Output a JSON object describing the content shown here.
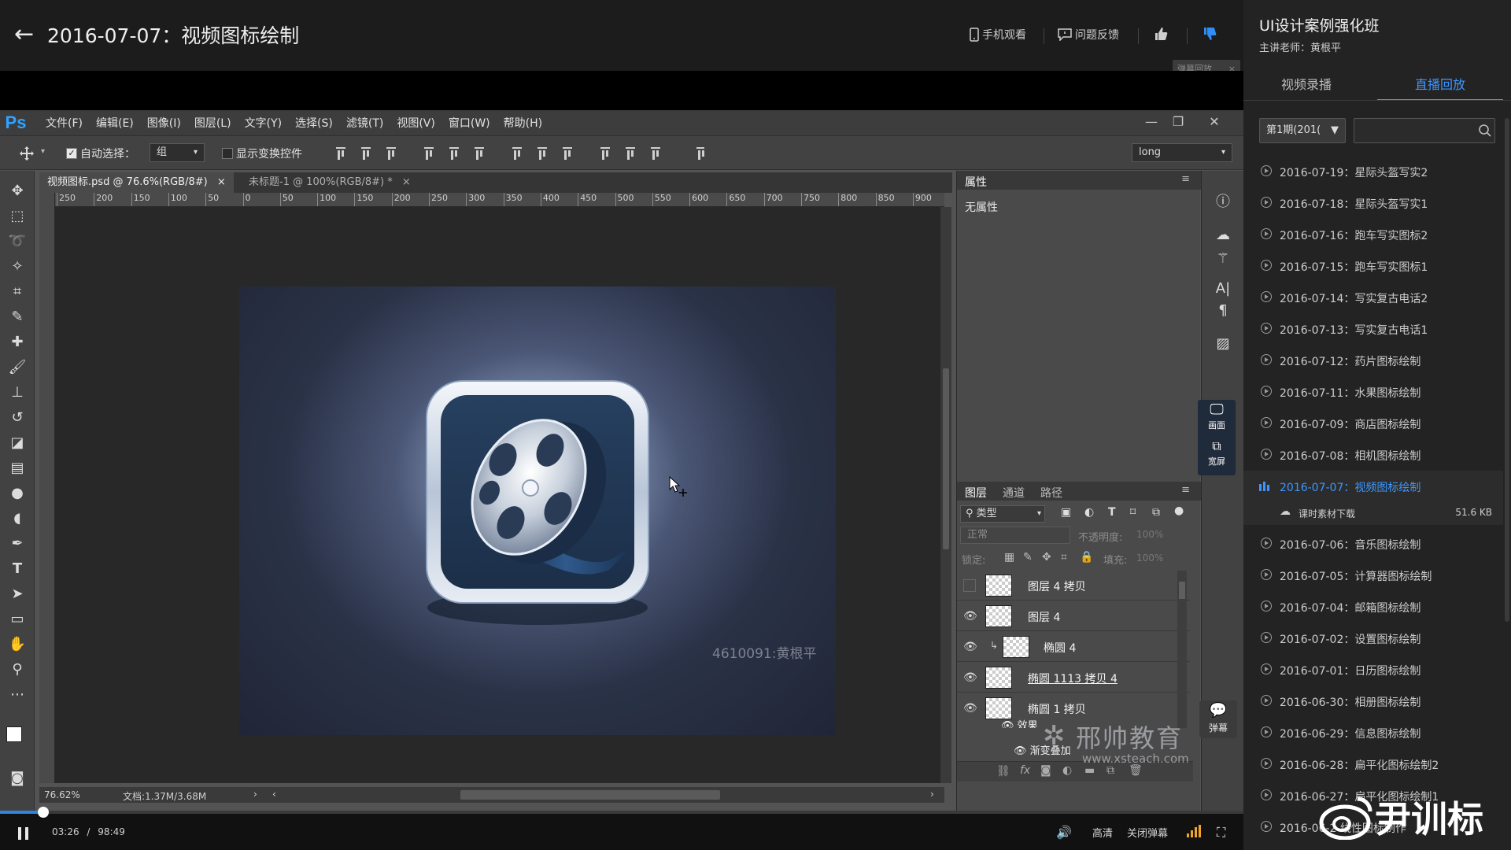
{
  "header": {
    "title": "2016-07-07：视频图标绘制",
    "mobile_watch": "手机观看",
    "feedback": "问题反馈",
    "danmu_replay": "弹幕回放",
    "danmu_replay_close": "×"
  },
  "photoshop": {
    "logo": "Ps",
    "menu": [
      "文件(F)",
      "编辑(E)",
      "图像(I)",
      "图层(L)",
      "文字(Y)",
      "选择(S)",
      "滤镜(T)",
      "视图(V)",
      "窗口(W)",
      "帮助(H)"
    ],
    "options": {
      "auto_select_label": "自动选择：",
      "auto_select_value": "组",
      "show_transform_label": "显示变换控件",
      "workspace_value": "long"
    },
    "tabs": [
      {
        "label": "视频图标.psd @ 76.6%(RGB/8#)",
        "close": "×"
      },
      {
        "label": "未标题-1 @ 100%(RGB/8#) *",
        "close": "×"
      }
    ],
    "ruler_ticks": [
      "250",
      "200",
      "150",
      "100",
      "50",
      "0",
      "50",
      "100",
      "150",
      "200",
      "250",
      "300",
      "350",
      "400",
      "450",
      "500",
      "550",
      "600",
      "650",
      "700",
      "750",
      "800",
      "850",
      "900"
    ],
    "canvas_watermark": "4610091:黄根平",
    "status": {
      "zoom": "76.62%",
      "doc": "文档:1.37M/3.68M"
    },
    "properties": {
      "title": "属性",
      "empty": "无属性"
    },
    "layers_panel": {
      "tabs": [
        "图层",
        "通道",
        "路径"
      ],
      "filter_label": "类型",
      "blend_mode": "正常",
      "opacity_label": "不透明度:",
      "opacity_value": "100%",
      "lock_label": "锁定:",
      "fill_label": "填充:",
      "fill_value": "100%",
      "layers": [
        {
          "name": "图层 4 拷贝",
          "visible": false
        },
        {
          "name": "图层 4",
          "visible": true
        },
        {
          "name": "椭圆 4",
          "visible": true
        },
        {
          "name": "椭圆 1113 拷贝 4",
          "visible": true
        },
        {
          "name": "椭圆 1 拷贝",
          "visible": true
        }
      ],
      "effects_label": "效果",
      "gradient_overlay_label": "渐变叠加"
    }
  },
  "overlays": {
    "view_mode": [
      {
        "label": "画面",
        "icon": "monitor-icon"
      },
      {
        "label": "宽屏",
        "icon": "widescreen-icon"
      }
    ],
    "danmu_label": "弹幕",
    "xs_brand": "邢帅教育",
    "xs_url": "www.xsteach.com",
    "weibo_brand": "尹训标"
  },
  "player": {
    "current_time": "03:26",
    "separator": "/",
    "total_time": "98:49",
    "progress": 0.035,
    "quality": "高清",
    "close_danmu": "关闭弹幕"
  },
  "sidebar": {
    "course_title": "UI设计案例强化班",
    "teacher": "主讲老师：黄根平",
    "tabs": [
      {
        "label": "视频录播",
        "active": false
      },
      {
        "label": "直播回放",
        "active": true
      }
    ],
    "period": "第1期(201(",
    "search_placeholder": "",
    "items": [
      {
        "label": "2016-07-19：星际头盔写实2"
      },
      {
        "label": "2016-07-18：星际头盔写实1"
      },
      {
        "label": "2016-07-16：跑车写实图标2"
      },
      {
        "label": "2016-07-15：跑车写实图标1"
      },
      {
        "label": "2016-07-14：写实复古电话2"
      },
      {
        "label": "2016-07-13：写实复古电话1"
      },
      {
        "label": "2016-07-12：药片图标绘制"
      },
      {
        "label": "2016-07-11：水果图标绘制"
      },
      {
        "label": "2016-07-09：商店图标绘制"
      },
      {
        "label": "2016-07-08：相机图标绘制"
      },
      {
        "label": "2016-07-07：视频图标绘制",
        "active": true
      },
      {
        "label": "2016-07-06：音乐图标绘制"
      },
      {
        "label": "2016-07-05：计算器图标绘制"
      },
      {
        "label": "2016-07-04：邮箱图标绘制"
      },
      {
        "label": "2016-07-02：设置图标绘制"
      },
      {
        "label": "2016-07-01：日历图标绘制"
      },
      {
        "label": "2016-06-30：相册图标绘制"
      },
      {
        "label": "2016-06-29：信息图标绘制"
      },
      {
        "label": "2016-06-28：扁平化图标绘制2"
      },
      {
        "label": "2016-06-27：扁平化图标绘制1"
      },
      {
        "label": "2016-06-2 线性图标制作"
      }
    ],
    "download": {
      "label": "课时素材下载",
      "size": "51.6 KB"
    }
  }
}
